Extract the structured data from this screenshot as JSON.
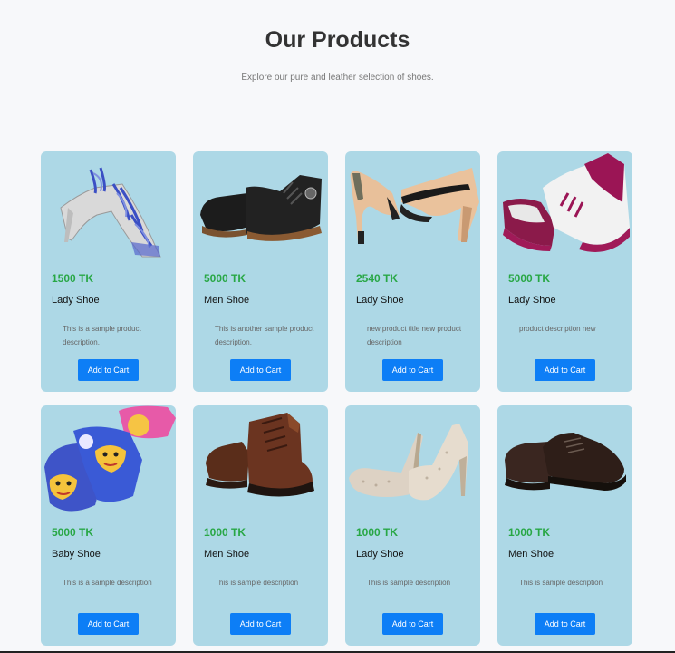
{
  "header": {
    "title": "Our Products",
    "subtitle": "Explore our pure and leather selection of shoes."
  },
  "products": [
    {
      "price": "1500 TK",
      "name": "Lady Shoe",
      "description": "This is a sample product description.",
      "button": "Add to Cart",
      "image": "clear-strappy-heel"
    },
    {
      "price": "5000 TK",
      "name": "Men Shoe",
      "description": "This is another sample product description.",
      "button": "Add to Cart",
      "image": "black-boots"
    },
    {
      "price": "2540 TK",
      "name": "Lady Shoe",
      "description": "new product title new product description",
      "button": "Add to Cart",
      "image": "nude-platform-heels"
    },
    {
      "price": "5000 TK",
      "name": "Lady Shoe",
      "description": "product description new",
      "button": "Add to Cart",
      "image": "magenta-sneakers"
    },
    {
      "price": "5000 TK",
      "name": "Baby Shoe",
      "description": "This is a sample description",
      "button": "Add to Cart",
      "image": "kids-tiger-slides"
    },
    {
      "price": "1000 TK",
      "name": "Men Shoe",
      "description": "This is sample description",
      "button": "Add to Cart",
      "image": "brown-boots"
    },
    {
      "price": "1000 TK",
      "name": "Lady Shoe",
      "description": "This is sample description",
      "button": "Add to Cart",
      "image": "glitter-pumps"
    },
    {
      "price": "1000 TK",
      "name": "Men Shoe",
      "description": "This is sample description",
      "button": "Add to Cart",
      "image": "dark-brown-derby"
    }
  ],
  "colors": {
    "page_bg": "#f7f8fa",
    "card_bg": "#add8e6",
    "price": "#28a745",
    "button": "#0d7ef6"
  }
}
